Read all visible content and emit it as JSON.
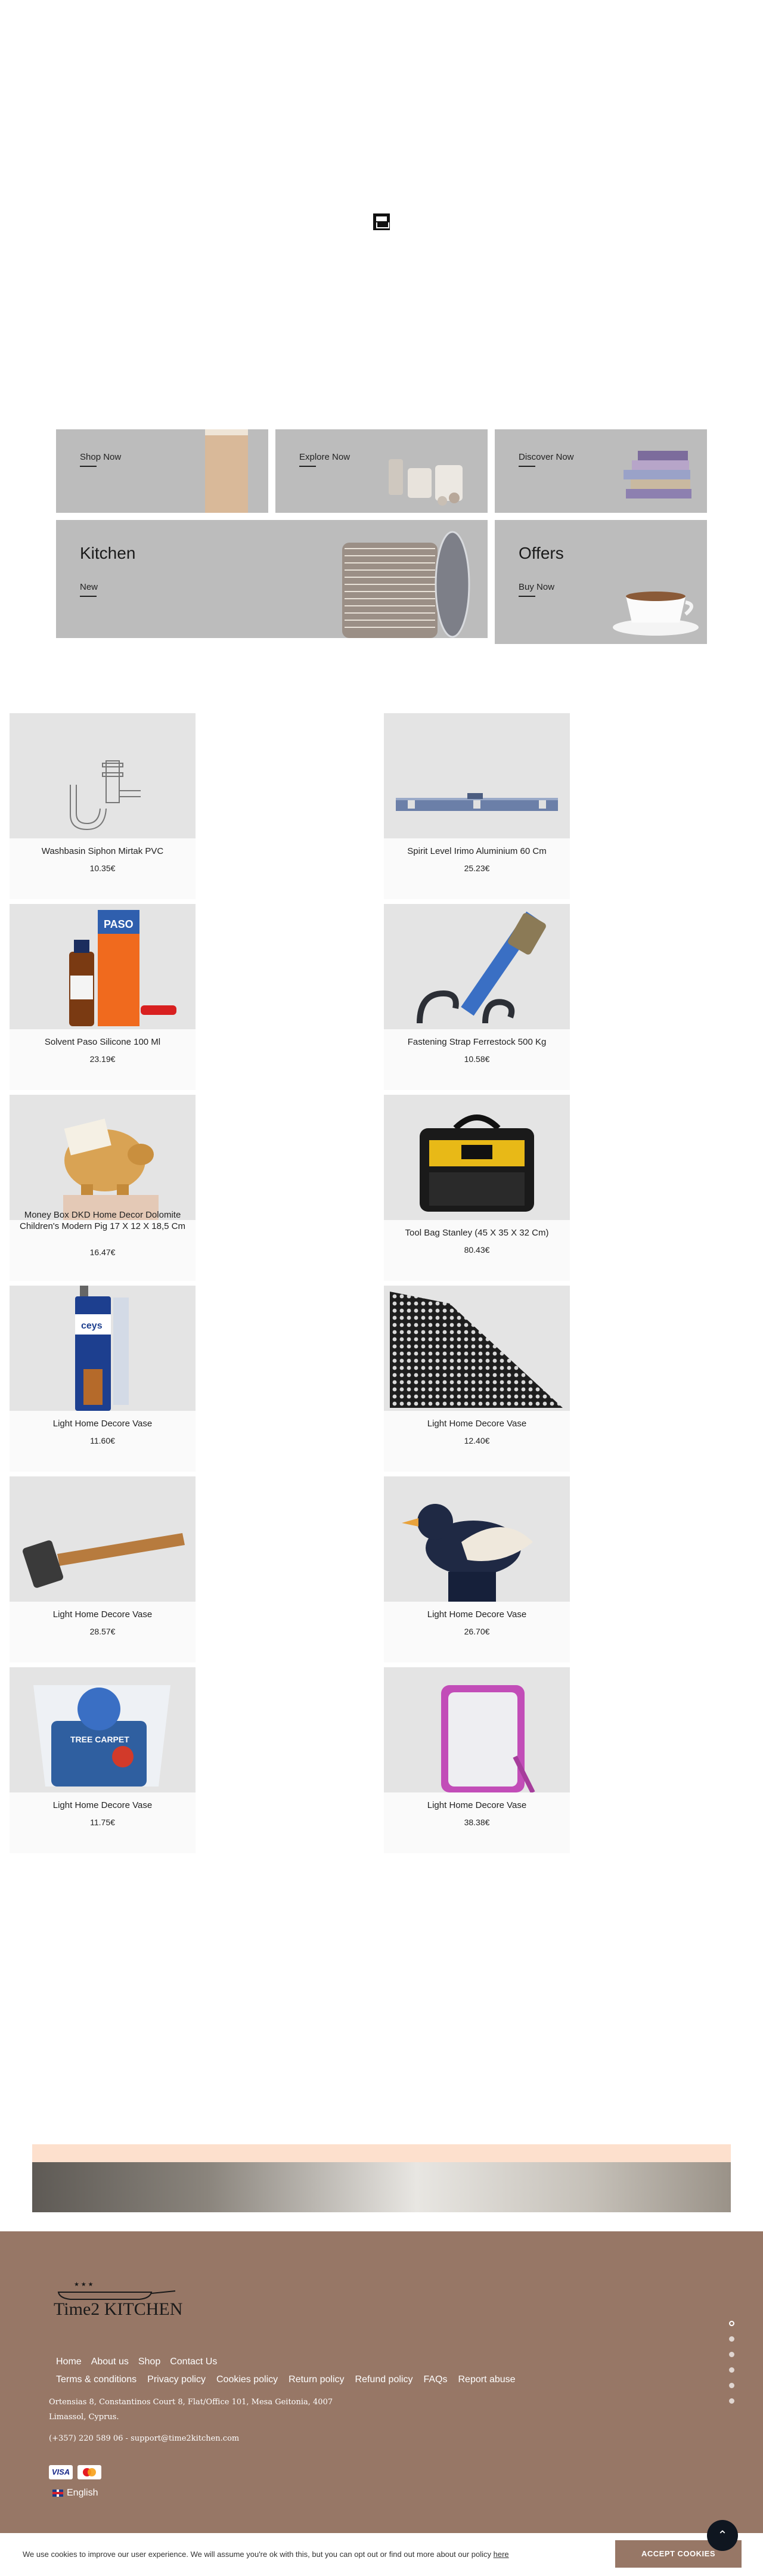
{
  "categories": {
    "row1": [
      {
        "link": "Shop Now"
      },
      {
        "link": "Explore Now"
      },
      {
        "link": "Discover Now"
      }
    ],
    "row2": [
      {
        "title": "Kitchen",
        "link": "New"
      },
      {
        "title": "Offers",
        "link": "Buy Now"
      }
    ]
  },
  "products": [
    {
      "name": "Washbasin Siphon Mirtak PVC",
      "price": "10.35€",
      "icon": "siphon-icon"
    },
    {
      "name": "Spirit Level Irimo Aluminium 60 Cm",
      "price": "25.23€",
      "icon": "spirit-level-icon"
    },
    {
      "name": "Solvent Paso Silicone 100 Ml",
      "price": "23.19€",
      "icon": "solvent-bottle-icon"
    },
    {
      "name": "Fastening Strap Ferrestock 500 Kg",
      "price": "10.58€",
      "icon": "strap-icon"
    },
    {
      "name": "Money Box DKD Home Decor Dolomite Children's Modern Pig 17 X 12 X 18,5 Cm",
      "price": "16.47€",
      "icon": "piggy-bank-icon"
    },
    {
      "name": "Tool Bag Stanley (45 X 35 X 32 Cm)",
      "price": "80.43€",
      "icon": "tool-bag-icon"
    },
    {
      "name": "Light Home Decore Vase",
      "price": "11.60€",
      "icon": "sealant-tube-icon"
    },
    {
      "name": "Light Home Decore Vase",
      "price": "12.40€",
      "icon": "mesh-icon"
    },
    {
      "name": "Light Home Decore Vase",
      "price": "28.57€",
      "icon": "hammer-icon"
    },
    {
      "name": "Light Home Decore Vase",
      "price": "26.70€",
      "icon": "bird-figure-icon"
    },
    {
      "name": "Light Home Decore Vase",
      "price": "11.75€",
      "icon": "tree-carpet-bag-icon"
    },
    {
      "name": "Light Home Decore Vase",
      "price": "38.38€",
      "icon": "mirror-icon"
    }
  ],
  "footer": {
    "logo_text": "Time2 KITCHEN",
    "nav": [
      "Home",
      "About us",
      "Shop",
      "Contact Us"
    ],
    "nav2": [
      "Terms & conditions",
      "Privacy policy",
      "Cookies policy",
      "Return policy",
      "Refund policy",
      "FAQs",
      "Report abuse"
    ],
    "address_line1": "Ortensias 8, Constantinos Court 8, Flat/Office 101, Mesa Geitonia, 4007",
    "address_line2": "Limassol, Cyprus.",
    "contact": "(+357) 220 589 06 - support@time2kitchen.com",
    "payment_visa": "VISA",
    "language": "English"
  },
  "cookie": {
    "text": "We use cookies to improve our user experience. We will assume you're ok with this, but you can opt out or find out more about our policy",
    "link": "here",
    "accept": "ACCEPT COOKIES"
  },
  "colors": {
    "footer_bg": "#977766",
    "banner_gray": "#bcbcbc",
    "peach": "#fde0cd"
  }
}
